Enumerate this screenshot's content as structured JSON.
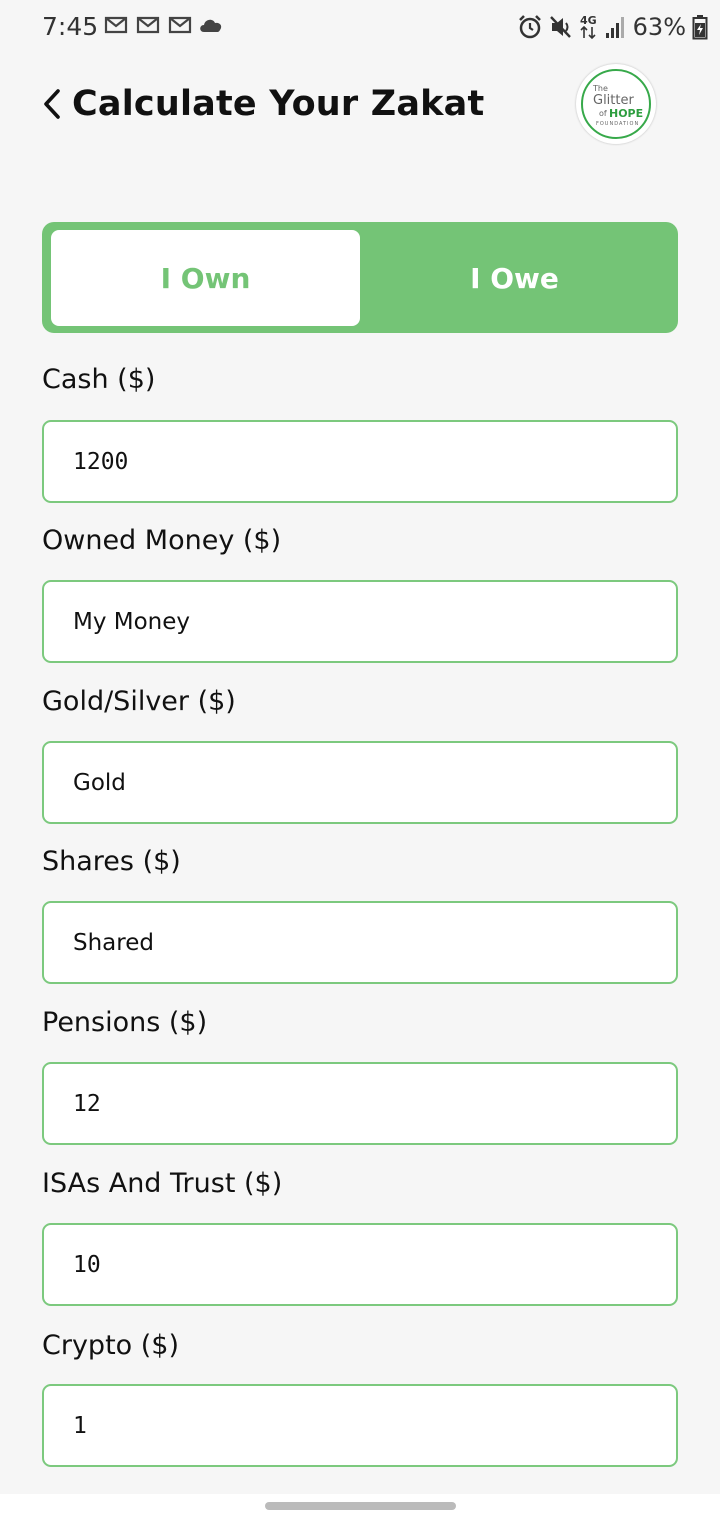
{
  "status_bar": {
    "time": "7:45",
    "notifications": [
      "gmail-icon",
      "gmail-icon",
      "gmail-icon",
      "cloud-icon"
    ],
    "network": "4G",
    "battery": "63%"
  },
  "header": {
    "title": "Calculate Your Zakat",
    "logo": {
      "the": "The",
      "glitter": "Glitter",
      "of": "of",
      "hope": "HOPE",
      "foundation": "FOUNDATION"
    }
  },
  "tabs": {
    "own": "I Own",
    "owe": "I Owe",
    "selected": "own"
  },
  "fields": [
    {
      "label": "Cash ($)",
      "value": "1200"
    },
    {
      "label": "Owned Money ($)",
      "value": "My Money"
    },
    {
      "label": "Gold/Silver ($)",
      "value": "Gold"
    },
    {
      "label": "Shares ($)",
      "value": "Shared"
    },
    {
      "label": "Pensions ($)",
      "value": "12"
    },
    {
      "label": "ISAs And Trust ($)",
      "value": "10"
    },
    {
      "label": "Crypto ($)",
      "value": "1"
    }
  ],
  "colors": {
    "accent": "#74c476",
    "border": "#7cc97e",
    "background": "#f6f6f6"
  }
}
